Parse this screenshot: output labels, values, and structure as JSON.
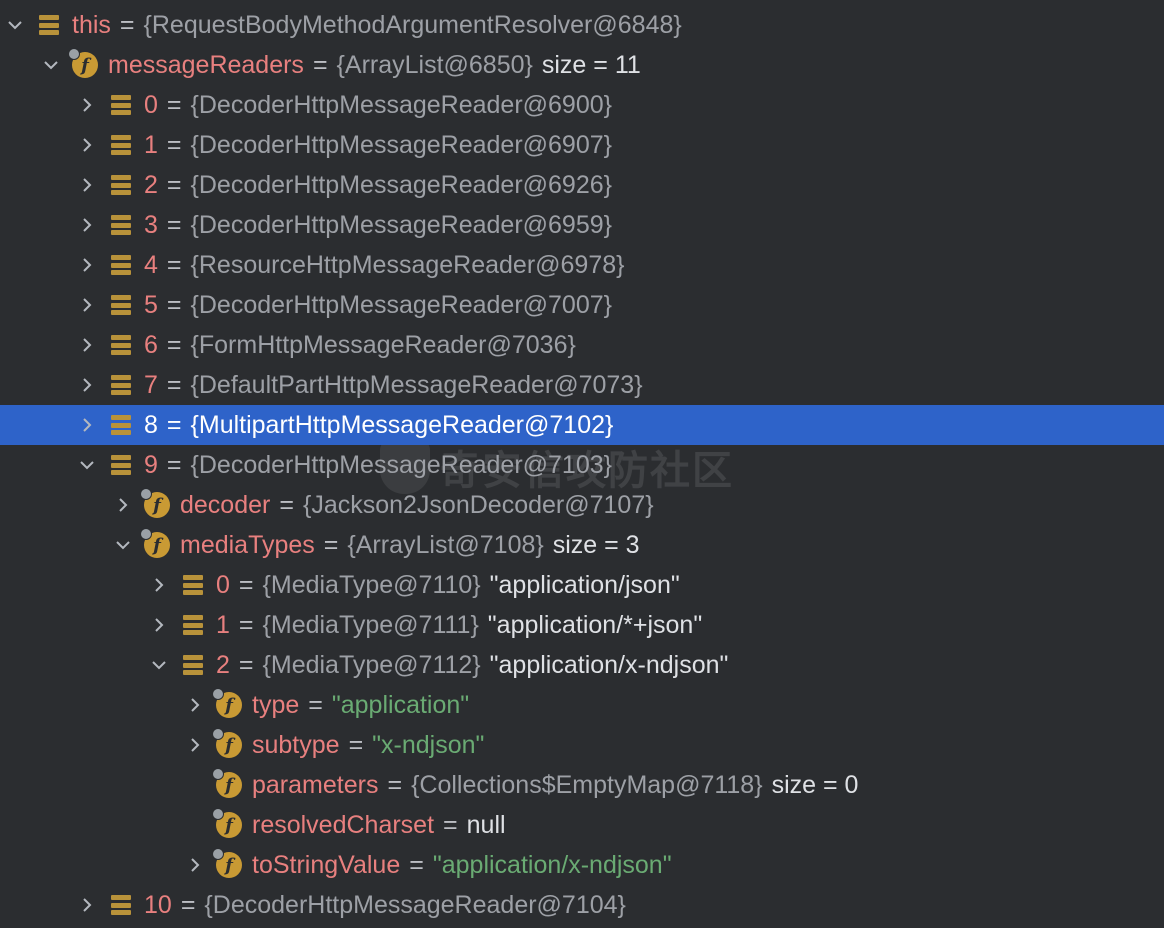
{
  "colors": {
    "background": "#2b2d30",
    "selection": "#2e63c9",
    "field_name": "#e8807f",
    "string_value": "#6aab73",
    "object_ref": "#9da0a6",
    "icon": "#c99a34"
  },
  "watermark": "奇安信攻防社区",
  "rows": [
    {
      "name": "this",
      "eq": "=",
      "value": "{RequestBodyMethodArgumentResolver@6848}",
      "extra": "",
      "icon": "array-icon",
      "arrow": "expanded"
    },
    {
      "name": "messageReaders",
      "eq": "=",
      "value": "{ArrayList@6850}",
      "extra": "size = 11",
      "icon": "field-icon",
      "arrow": "expanded"
    },
    {
      "name": "0",
      "eq": "=",
      "value": "{DecoderHttpMessageReader@6900}",
      "extra": "",
      "icon": "array-icon",
      "arrow": "collapsed"
    },
    {
      "name": "1",
      "eq": "=",
      "value": "{DecoderHttpMessageReader@6907}",
      "extra": "",
      "icon": "array-icon",
      "arrow": "collapsed"
    },
    {
      "name": "2",
      "eq": "=",
      "value": "{DecoderHttpMessageReader@6926}",
      "extra": "",
      "icon": "array-icon",
      "arrow": "collapsed"
    },
    {
      "name": "3",
      "eq": "=",
      "value": "{DecoderHttpMessageReader@6959}",
      "extra": "",
      "icon": "array-icon",
      "arrow": "collapsed"
    },
    {
      "name": "4",
      "eq": "=",
      "value": "{ResourceHttpMessageReader@6978}",
      "extra": "",
      "icon": "array-icon",
      "arrow": "collapsed"
    },
    {
      "name": "5",
      "eq": "=",
      "value": "{DecoderHttpMessageReader@7007}",
      "extra": "",
      "icon": "array-icon",
      "arrow": "collapsed"
    },
    {
      "name": "6",
      "eq": "=",
      "value": "{FormHttpMessageReader@7036}",
      "extra": "",
      "icon": "array-icon",
      "arrow": "collapsed"
    },
    {
      "name": "7",
      "eq": "=",
      "value": "{DefaultPartHttpMessageReader@7073}",
      "extra": "",
      "icon": "array-icon",
      "arrow": "collapsed"
    },
    {
      "name": "8",
      "eq": "=",
      "value": "{MultipartHttpMessageReader@7102}",
      "extra": "",
      "icon": "array-icon",
      "arrow": "collapsed",
      "selected": true
    },
    {
      "name": "9",
      "eq": "=",
      "value": "{DecoderHttpMessageReader@7103}",
      "extra": "",
      "icon": "array-icon",
      "arrow": "expanded"
    },
    {
      "name": "decoder",
      "eq": "=",
      "value": "{Jackson2JsonDecoder@7107}",
      "extra": "",
      "icon": "field-icon",
      "arrow": "collapsed"
    },
    {
      "name": "mediaTypes",
      "eq": "=",
      "value": "{ArrayList@7108}",
      "extra": "size = 3",
      "icon": "field-icon",
      "arrow": "expanded"
    },
    {
      "name": "0",
      "eq": "=",
      "value": "{MediaType@7110}",
      "extra": "\"application/json\"",
      "icon": "array-icon",
      "arrow": "collapsed"
    },
    {
      "name": "1",
      "eq": "=",
      "value": "{MediaType@7111}",
      "extra": "\"application/*+json\"",
      "icon": "array-icon",
      "arrow": "collapsed"
    },
    {
      "name": "2",
      "eq": "=",
      "value": "{MediaType@7112}",
      "extra": "\"application/x-ndjson\"",
      "icon": "array-icon",
      "arrow": "expanded"
    },
    {
      "name": "type",
      "eq": "=",
      "value": "\"application\"",
      "extra": "",
      "icon": "field-icon",
      "arrow": "collapsed",
      "string": true
    },
    {
      "name": "subtype",
      "eq": "=",
      "value": "\"x-ndjson\"",
      "extra": "",
      "icon": "field-icon",
      "arrow": "collapsed",
      "string": true
    },
    {
      "name": "parameters",
      "eq": "=",
      "value": "{Collections$EmptyMap@7118}",
      "extra": "size = 0",
      "icon": "field-icon",
      "arrow": "none"
    },
    {
      "name": "resolvedCharset",
      "eq": "=",
      "value": "null",
      "extra": "",
      "icon": "field-icon",
      "arrow": "none",
      "null": true
    },
    {
      "name": "toStringValue",
      "eq": "=",
      "value": "\"application/x-ndjson\"",
      "extra": "",
      "icon": "field-icon",
      "arrow": "collapsed",
      "string": true
    },
    {
      "name": "10",
      "eq": "=",
      "value": "{DecoderHttpMessageReader@7104}",
      "extra": "",
      "icon": "array-icon",
      "arrow": "collapsed"
    }
  ]
}
